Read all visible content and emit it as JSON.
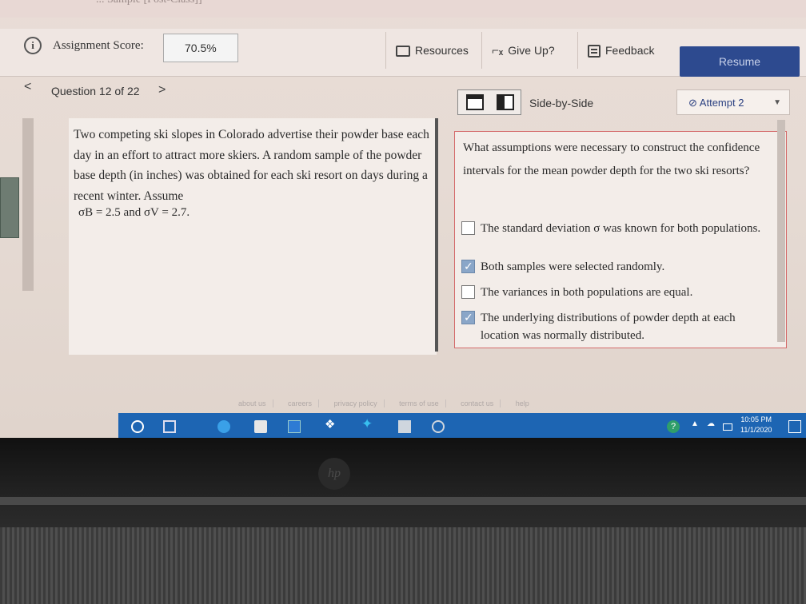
{
  "header": {
    "top_strip_text": "... Sample [Post-Class]]",
    "assignment_score_label": "Assignment Score:",
    "assignment_score_value": "70.5%",
    "resources_label": "Resources",
    "giveup_label": "Give Up?",
    "feedback_label": "Feedback",
    "resume_label": "Resume"
  },
  "nav": {
    "prev_symbol": "<",
    "question_label": "Question 12 of 22",
    "next_symbol": ">",
    "side_by_side_label": "Side-by-Side",
    "attempt_label": "Attempt 2"
  },
  "problem": {
    "text": "Two competing ski slopes in Colorado advertise their powder base each day in an effort to attract more skiers. A random sample of the powder base depth (in inches) was obtained for each ski resort on days during a recent winter. Assume",
    "given": "σB = 2.5 and σV = 2.7."
  },
  "question": {
    "text": "What assumptions were necessary to construct the confidence intervals for the mean powder depth for the two ski resorts?",
    "options": [
      {
        "label": "The standard deviation σ was known for both populations.",
        "checked": false
      },
      {
        "label": "Both samples were selected randomly.",
        "checked": true
      },
      {
        "label": "The variances in both populations are equal.",
        "checked": false
      },
      {
        "label": "The underlying distributions of powder depth at each location was normally distributed.",
        "checked": true
      }
    ]
  },
  "footer": {
    "links": [
      "about us",
      "careers",
      "privacy policy",
      "terms of use",
      "contact us",
      "help"
    ]
  },
  "taskbar": {
    "time": "10:05 PM",
    "date": "11/1/2020",
    "help_glyph": "?"
  },
  "bezel": {
    "logo_text": "hp"
  },
  "colors": {
    "resume_bg": "#2d4a8f",
    "taskbar_bg": "#1d65b3",
    "checked_box": "#8aa6c8",
    "attempt_text": "#2a3f80"
  }
}
